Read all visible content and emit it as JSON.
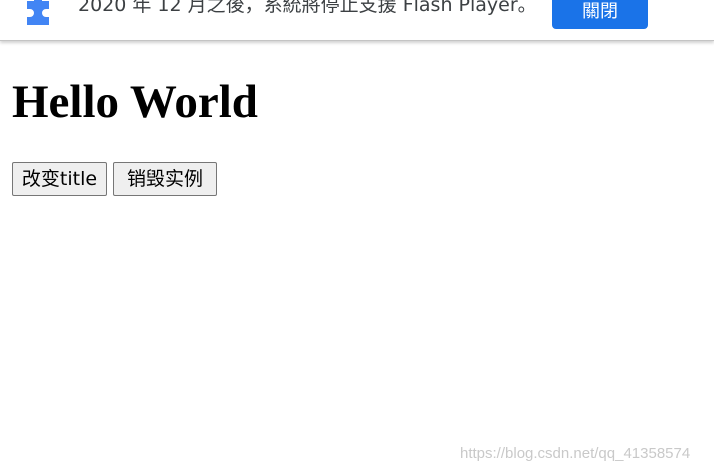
{
  "infobar": {
    "icon": "puzzle-piece-icon",
    "icon_color": "#4285f4",
    "message": "2020 年 12 月之後，系統將停止支援 Flash Player。",
    "close_label": "關閉",
    "button_color": "#1a73e8"
  },
  "page": {
    "heading": "Hello World",
    "buttons": {
      "change_title": "改变title",
      "destroy_instance": "销毁实例"
    }
  },
  "watermark": "https://blog.csdn.net/qq_41358574"
}
